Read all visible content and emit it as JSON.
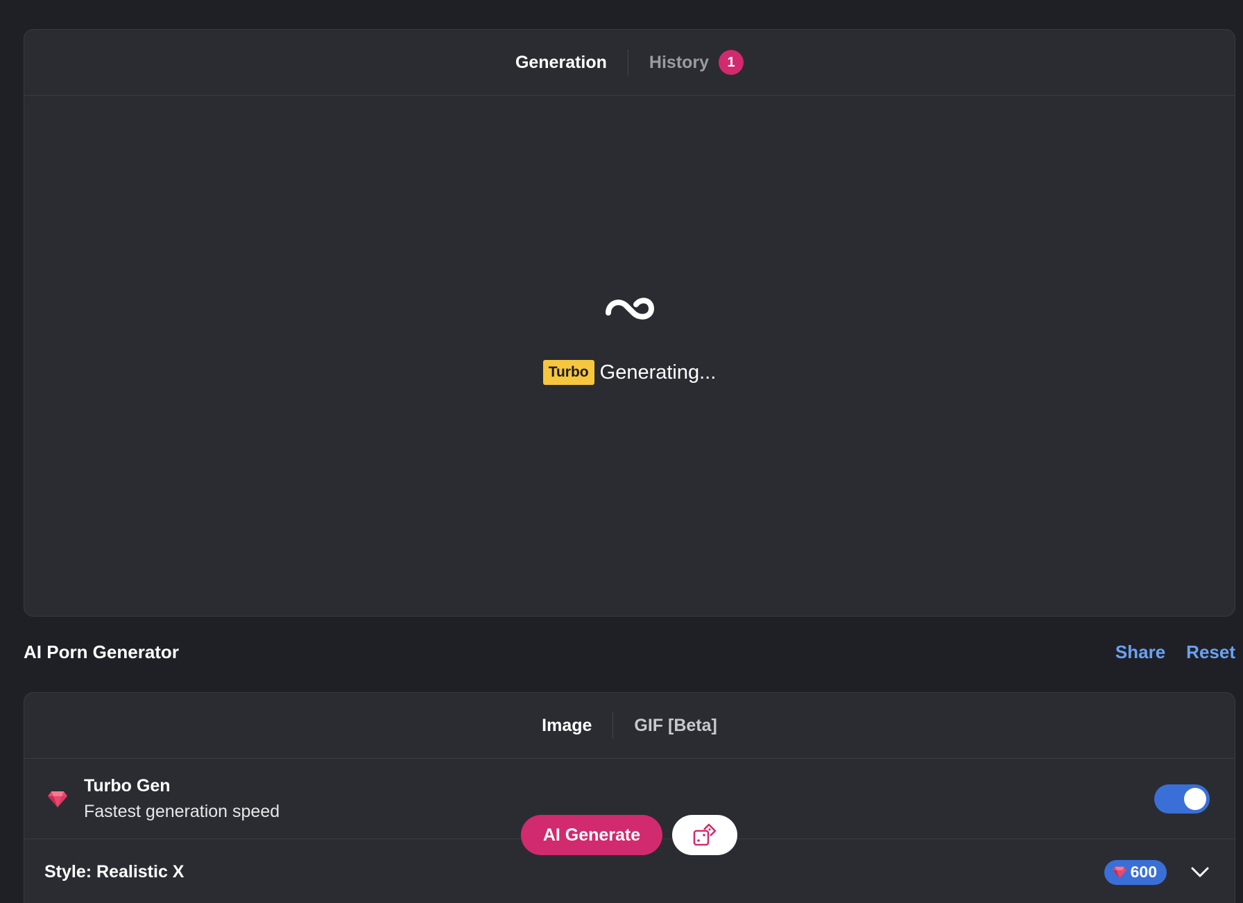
{
  "tabs": {
    "generation_label": "Generation",
    "history_label": "History",
    "history_count": "1"
  },
  "status": {
    "tag": "Turbo",
    "text": "Generating..."
  },
  "header": {
    "title": "AI Porn Generator",
    "share_label": "Share",
    "reset_label": "Reset"
  },
  "mode_tabs": {
    "image_label": "Image",
    "gif_label": "GIF [Beta]"
  },
  "turbo": {
    "title": "Turbo Gen",
    "subtitle": "Fastest generation speed",
    "enabled": true
  },
  "style": {
    "label": "Style: Realistic X",
    "cost": "600"
  },
  "actions": {
    "generate_label": "AI Generate"
  },
  "icons": {
    "loading": "infinity-loader-icon",
    "gem": "gem-icon",
    "chevron": "chevron-down-icon",
    "dice": "dice-icon"
  },
  "colors": {
    "accent_pink": "#d22a6e",
    "accent_blue": "#3a6fd8",
    "link_blue": "#6aa2f3",
    "turbo_yellow": "#f6c63f"
  }
}
